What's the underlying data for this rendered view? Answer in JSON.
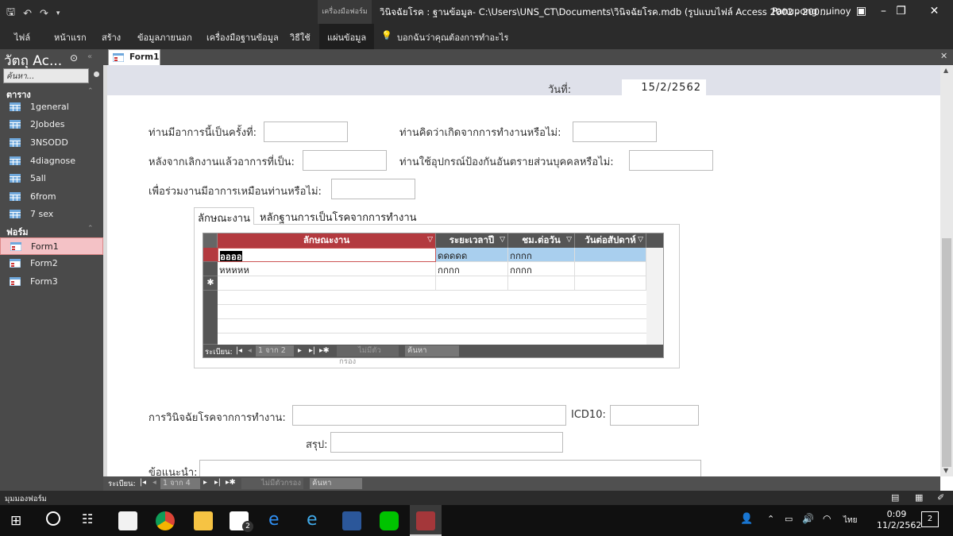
{
  "titlebar": {
    "context_label": "เครื่องมือฟอร์ม",
    "window_title": "วินิจฉัยโรค : ฐานข้อมูล- C:\\Users\\UNS_CT\\Documents\\วินิจฉัยโรค.mdb (รูปแบบไฟล์ Access 2002 - 200...",
    "user": "Panupong nuinoy"
  },
  "ribbon": {
    "tabs": [
      "ไฟล์",
      "หน้าแรก",
      "สร้าง",
      "ข้อมูลภายนอก",
      "เครื่องมือฐานข้อมูล",
      "วิธีใช้",
      "แผ่นข้อมูล"
    ],
    "tell_me": "บอกฉันว่าคุณต้องการทำอะไร"
  },
  "nav": {
    "title": "วัตถุ Ac...",
    "search_placeholder": "ค้นหา...",
    "tables_header": "ตาราง",
    "tables": [
      "1general",
      "2Jobdes",
      "3NSODD",
      "4diagnose",
      "5all",
      "6from",
      "7 sex"
    ],
    "forms_header": "ฟอร์ม",
    "forms": [
      "Form1",
      "Form2",
      "Form3"
    ]
  },
  "doc": {
    "tab_label": "Form1"
  },
  "form": {
    "date_label": "วันที่:",
    "date_value": "15/2/2562",
    "q1": "ท่านมีอาการนี้เป็นครั้งที่:",
    "q2": "ท่านคิดว่าเกิดจากการทำงานหรือไม่:",
    "q3": "หลังจากเลิกงานแล้วอาการที่เป็น:",
    "q4": "ท่านใช้อุปกรณ์ป้องกันอันตรายส่วนบุคคลหรือไม่:",
    "q5": "เพื่อร่วมงานมีอาการเหมือนท่านหรือไม่:",
    "diag_label": "การวินิจฉัยโรคจากการทำงาน:",
    "icd_label": "ICD10:",
    "summary_label": "สรุป:",
    "advice_label": "ข้อแนะนำ:"
  },
  "tabctrl": {
    "tabs": [
      "ลักษณะงาน",
      "หลักฐานการเป็นโรคจากการทำงาน"
    ]
  },
  "subform": {
    "columns": [
      "ลักษณะงาน",
      "ระยะเวลาปี",
      "ชม.ต่อวัน",
      "วันต่อสัปดาห์"
    ],
    "rows": [
      [
        "ออออ",
        "ดดดดด",
        "กกกก",
        ""
      ],
      [
        "หหหหห",
        "กกกก",
        "กกกก",
        ""
      ]
    ],
    "new_row_marker": "✱",
    "nav": {
      "label": "ระเบียน:",
      "position": "1 จาก 2",
      "filter": "ไม่มีตัวกรอง",
      "search": "ค้นหา"
    }
  },
  "main_recnav": {
    "label": "ระเบียน:",
    "position": "1 จาก 4",
    "filter": "ไม่มีตัวกรอง",
    "search": "ค้นหา"
  },
  "status": {
    "text": "มุมมองฟอร์ม"
  },
  "taskbar": {
    "lang": "ไทย",
    "time": "0:09",
    "date": "11/2/2562",
    "notif_count": "2",
    "mail_badge": "2"
  },
  "colors": {
    "accent": "#b33a3f",
    "highlight": "#a9cfee",
    "dark": "#2b2b2b"
  }
}
